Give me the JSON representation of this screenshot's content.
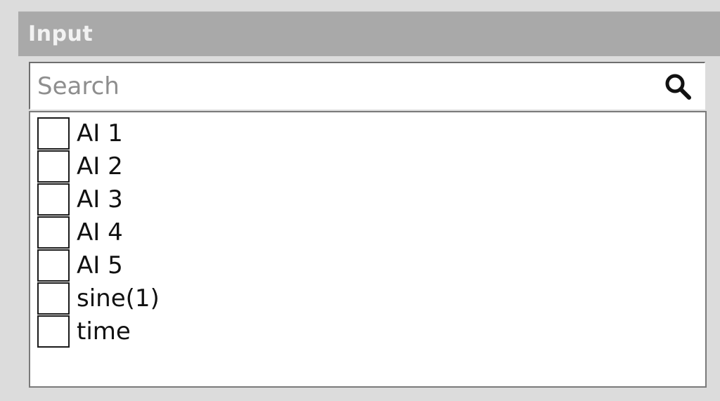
{
  "panel": {
    "title": "Input"
  },
  "search": {
    "placeholder": "Search",
    "value": "",
    "icon": "search-icon"
  },
  "channels": [
    {
      "label": "AI 1",
      "checked": false
    },
    {
      "label": "AI 2",
      "checked": false
    },
    {
      "label": "AI 3",
      "checked": false
    },
    {
      "label": "AI 4",
      "checked": false
    },
    {
      "label": "AI 5",
      "checked": false
    },
    {
      "label": "sine(1)",
      "checked": false
    },
    {
      "label": "time",
      "checked": false
    }
  ],
  "colors": {
    "background": "#dcdcdc",
    "header": "#a9a9a9",
    "header_text": "#f2f2f2",
    "field": "#ffffff",
    "border": "#7a7a7a"
  }
}
